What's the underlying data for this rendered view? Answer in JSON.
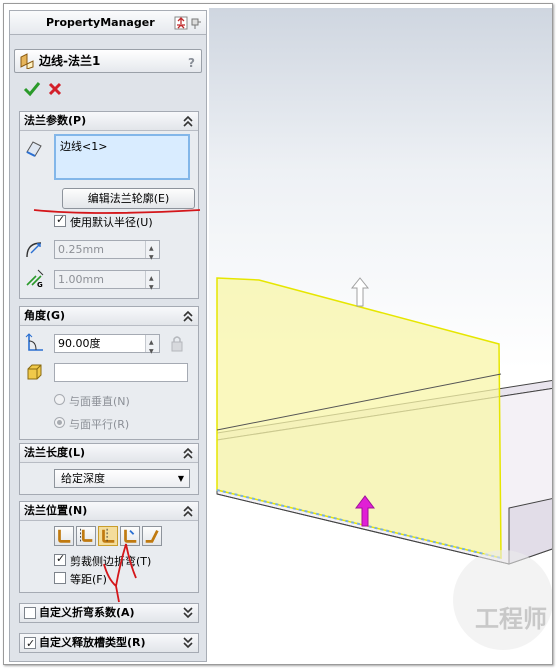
{
  "window": {
    "title": "PropertyManager"
  },
  "feature": {
    "title": "边线-法兰1",
    "help": "?"
  },
  "actions": {
    "ok": "✔",
    "cancel": "✖"
  },
  "flange_params": {
    "header": "法兰参数(P)",
    "edge_item": "边线<1>",
    "edit_profile_button": "编辑法兰轮廓(E)",
    "use_default_radius_label": "使用默认半径(U)",
    "use_default_radius_checked": true,
    "bend_radius": "0.25mm",
    "gap": "1.00mm"
  },
  "angle": {
    "header": "角度(G)",
    "value": "90.00度",
    "face_input": "",
    "perpendicular_label": "与面垂直(N)",
    "parallel_label": "与面平行(R)",
    "selected": "parallel"
  },
  "flange_length": {
    "header": "法兰长度(L)",
    "type": "给定深度"
  },
  "flange_position": {
    "header": "法兰位置(N)",
    "buttons": [
      "material-inside",
      "material-outside",
      "bend-outside",
      "virtual-sharp",
      "tangent-to-bend"
    ],
    "active_index": 2,
    "trim_label": "剪裁侧边折弯(T)",
    "trim_checked": true,
    "offset_label": "等距(F)",
    "offset_checked": false
  },
  "custom_bend": {
    "label": "自定义折弯系数(A)",
    "checked": false
  },
  "custom_relief": {
    "label": "自定义释放槽类型(R)",
    "checked": true
  },
  "watermark": {
    "text": "工程师"
  },
  "colors": {
    "preview_fill": "#f8f6a8",
    "preview_edge": "#e6e600",
    "arrow_gray": "#b8b8b8",
    "arrow_pink": "#e11fd6",
    "annotation": "#d4161a"
  }
}
